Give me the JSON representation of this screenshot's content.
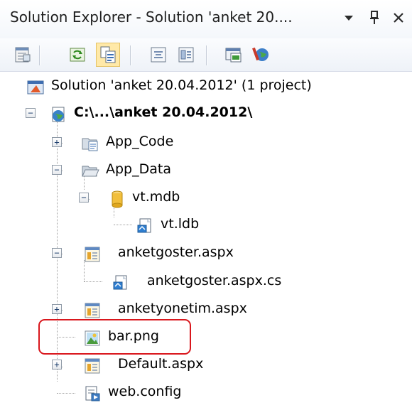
{
  "window": {
    "title": "Solution Explorer - Solution 'anket 20.... ",
    "dropdown_icon": "dropdown-arrow-icon",
    "pin_icon": "pin-icon",
    "close_icon": "close-icon"
  },
  "toolbar": {
    "buttons": [
      {
        "icon": "properties-icon",
        "name": "properties-button"
      },
      {
        "icon": "refresh-icon",
        "name": "refresh-button"
      },
      {
        "icon": "show-all-files-icon",
        "name": "show-all-files-button",
        "active": true
      },
      {
        "icon": "view-code-icon",
        "name": "view-code-button"
      },
      {
        "icon": "view-designer-icon",
        "name": "view-designer-button"
      },
      {
        "icon": "nest-related-files-icon",
        "name": "nest-related-files-button"
      },
      {
        "icon": "asp-net-configuration-icon",
        "name": "asp-net-configuration-button"
      }
    ]
  },
  "tree": {
    "solution": "Solution 'anket 20.04.2012' (1 project)",
    "project": "C:\\...\\anket 20.04.2012\\",
    "app_code": "App_Code",
    "app_data": "App_Data",
    "vt_mdb": "vt.mdb",
    "vt_ldb": "vt.ldb",
    "anketgoster_aspx": "anketgoster.aspx",
    "anketgoster_cs": "anketgoster.aspx.cs",
    "anketyonetim_aspx": "anketyonetim.aspx",
    "bar_png": "bar.png",
    "default_aspx": "Default.aspx",
    "web_config": "web.config",
    "expand_symbol": "+",
    "collapse_symbol": "−"
  },
  "colors": {
    "highlight": "#d9171d",
    "selection": "#ffe9a8"
  }
}
